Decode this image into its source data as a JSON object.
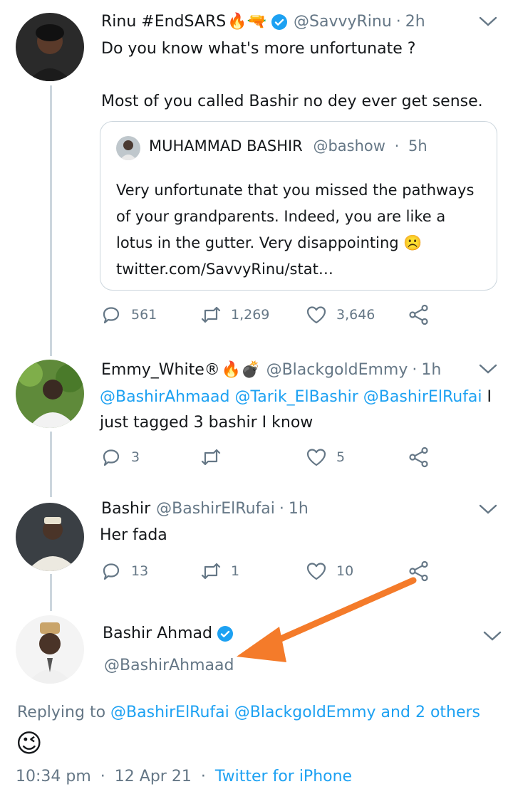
{
  "tweets": [
    {
      "name": "Rinu #EndSARS",
      "emojis": "🔥🔫",
      "handle": "@SavvyRinu",
      "time": "2h",
      "line1": "Do you know what's more unfortunate ?",
      "line2": "Most of you called Bashir no dey ever get sense.",
      "quote": {
        "name": "MUHAMMAD BASHIR",
        "handle": "@bashow",
        "time": "5h",
        "text": "Very unfortunate that you missed the pathways of your grandparents. Indeed, you are like a lotus in the gutter. Very disappointing ☹️ twitter.com/SavvyRinu/stat…"
      },
      "replies": "561",
      "retweets": "1,269",
      "likes": "3,646"
    },
    {
      "name": "Emmy_White®",
      "emojis": "🔥💣",
      "handle": "@BlackgoldEmmy",
      "time": "1h",
      "mentions": "@BashirAhmaad @Tarik_ElBashir @BashirElRufai",
      "text_tail": " I",
      "line2": "just tagged 3 bashir I know",
      "replies": "3",
      "retweets": "",
      "likes": "5"
    },
    {
      "name": "Bashir",
      "handle": "@BashirElRufai",
      "time": "1h",
      "text": "Her fada",
      "replies": "13",
      "retweets": "1",
      "likes": "10"
    }
  ],
  "main_tweet": {
    "name": "Bashir Ahmad",
    "handle": "@BashirAhmaad",
    "replying_prefix": "Replying to ",
    "replying_mentions": "@BashirElRufai @BlackgoldEmmy",
    "replying_and": " and ",
    "replying_others": "2 others",
    "emoji": "😉",
    "time": "10:34 pm",
    "date": "12 Apr 21",
    "source": "Twitter for iPhone"
  },
  "separator": "·",
  "colors": {
    "accent": "#1da1f2",
    "secondary_text": "#657786",
    "annotation_arrow": "#f47b2a"
  },
  "icons": [
    "reply-icon",
    "retweet-icon",
    "like-icon",
    "share-icon",
    "verified-icon",
    "chevron-down-icon"
  ]
}
